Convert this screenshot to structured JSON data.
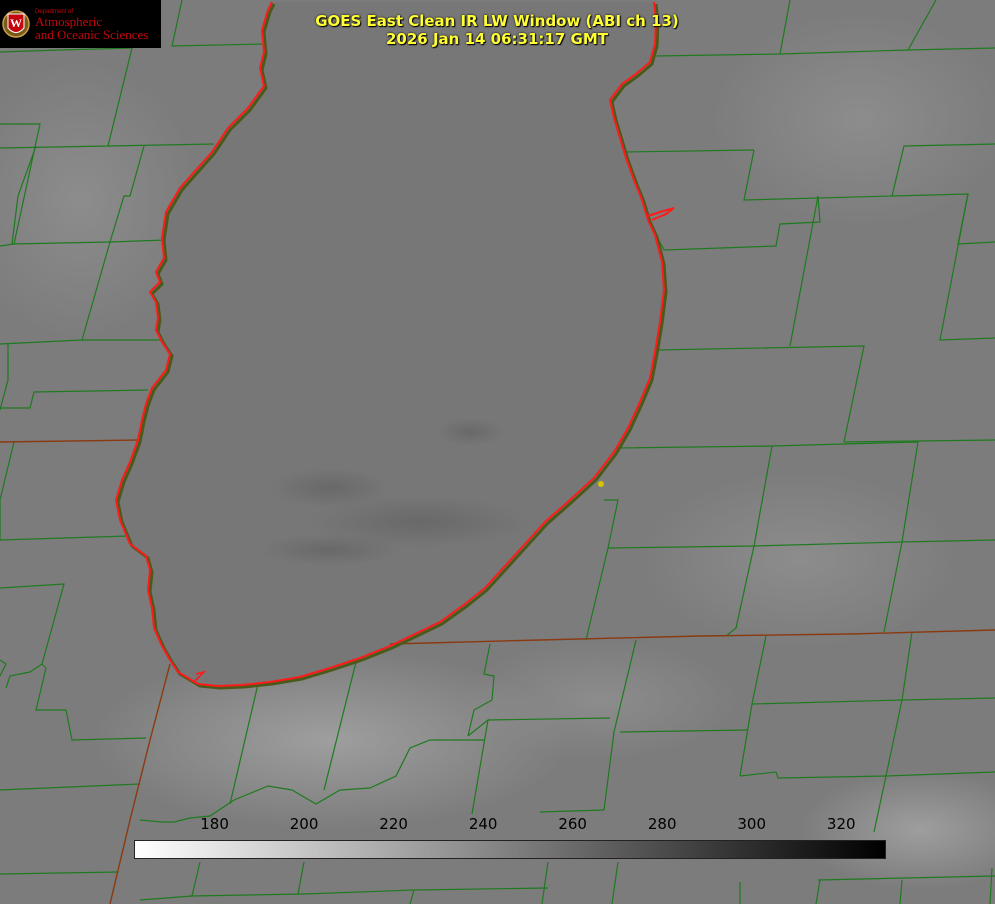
{
  "header": {
    "title_line1": "GOES East Clean IR LW Window (ABI ch 13)",
    "title_line2": "2026 Jan 14 06:31:17 GMT"
  },
  "logo": {
    "department": "Department of",
    "line1": "Atmospheric",
    "line2": "and Oceanic Sciences",
    "seal_letter": "W"
  },
  "colorbar": {
    "ticks": [
      "180",
      "200",
      "220",
      "240",
      "260",
      "280",
      "300",
      "320"
    ],
    "tick_values": [
      180,
      200,
      220,
      240,
      260,
      280,
      300,
      320
    ],
    "min_value": 162,
    "max_value": 330,
    "min_color": "#ffffff",
    "max_color": "#000000"
  },
  "colors": {
    "background": "#7a7a7a",
    "lake": "#777777",
    "county_lines": "#1f7a1f",
    "shoreline": "#ff1a1a",
    "state_line": "#8a3a10",
    "marker": "#d4c400",
    "title_text": "#ffff33"
  }
}
